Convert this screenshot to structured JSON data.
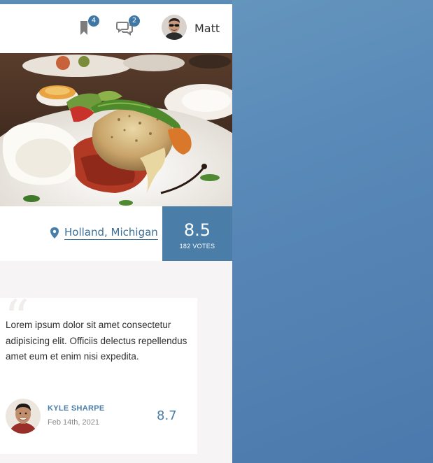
{
  "header": {
    "bookmarks_count": "4",
    "messages_count": "2",
    "username": "Matt"
  },
  "listing": {
    "location": "Holland, Michigan",
    "score": "8.5",
    "votes_label": "182 VOTES"
  },
  "review": {
    "text": "Lorem ipsum dolor sit amet consectetur adipisicing elit. Officiis delectus repellendus amet eum et enim nisi expedita.",
    "author": "KYLE SHARPE",
    "date": "Feb 14th, 2021",
    "score": "8.7"
  },
  "colors": {
    "accent": "#4a7ea8",
    "badge": "#3f78a7",
    "page_bg": "#f6f4f4"
  },
  "icons": [
    "bookmark-icon",
    "chat-icon",
    "location-pin-icon",
    "quote-icon"
  ]
}
